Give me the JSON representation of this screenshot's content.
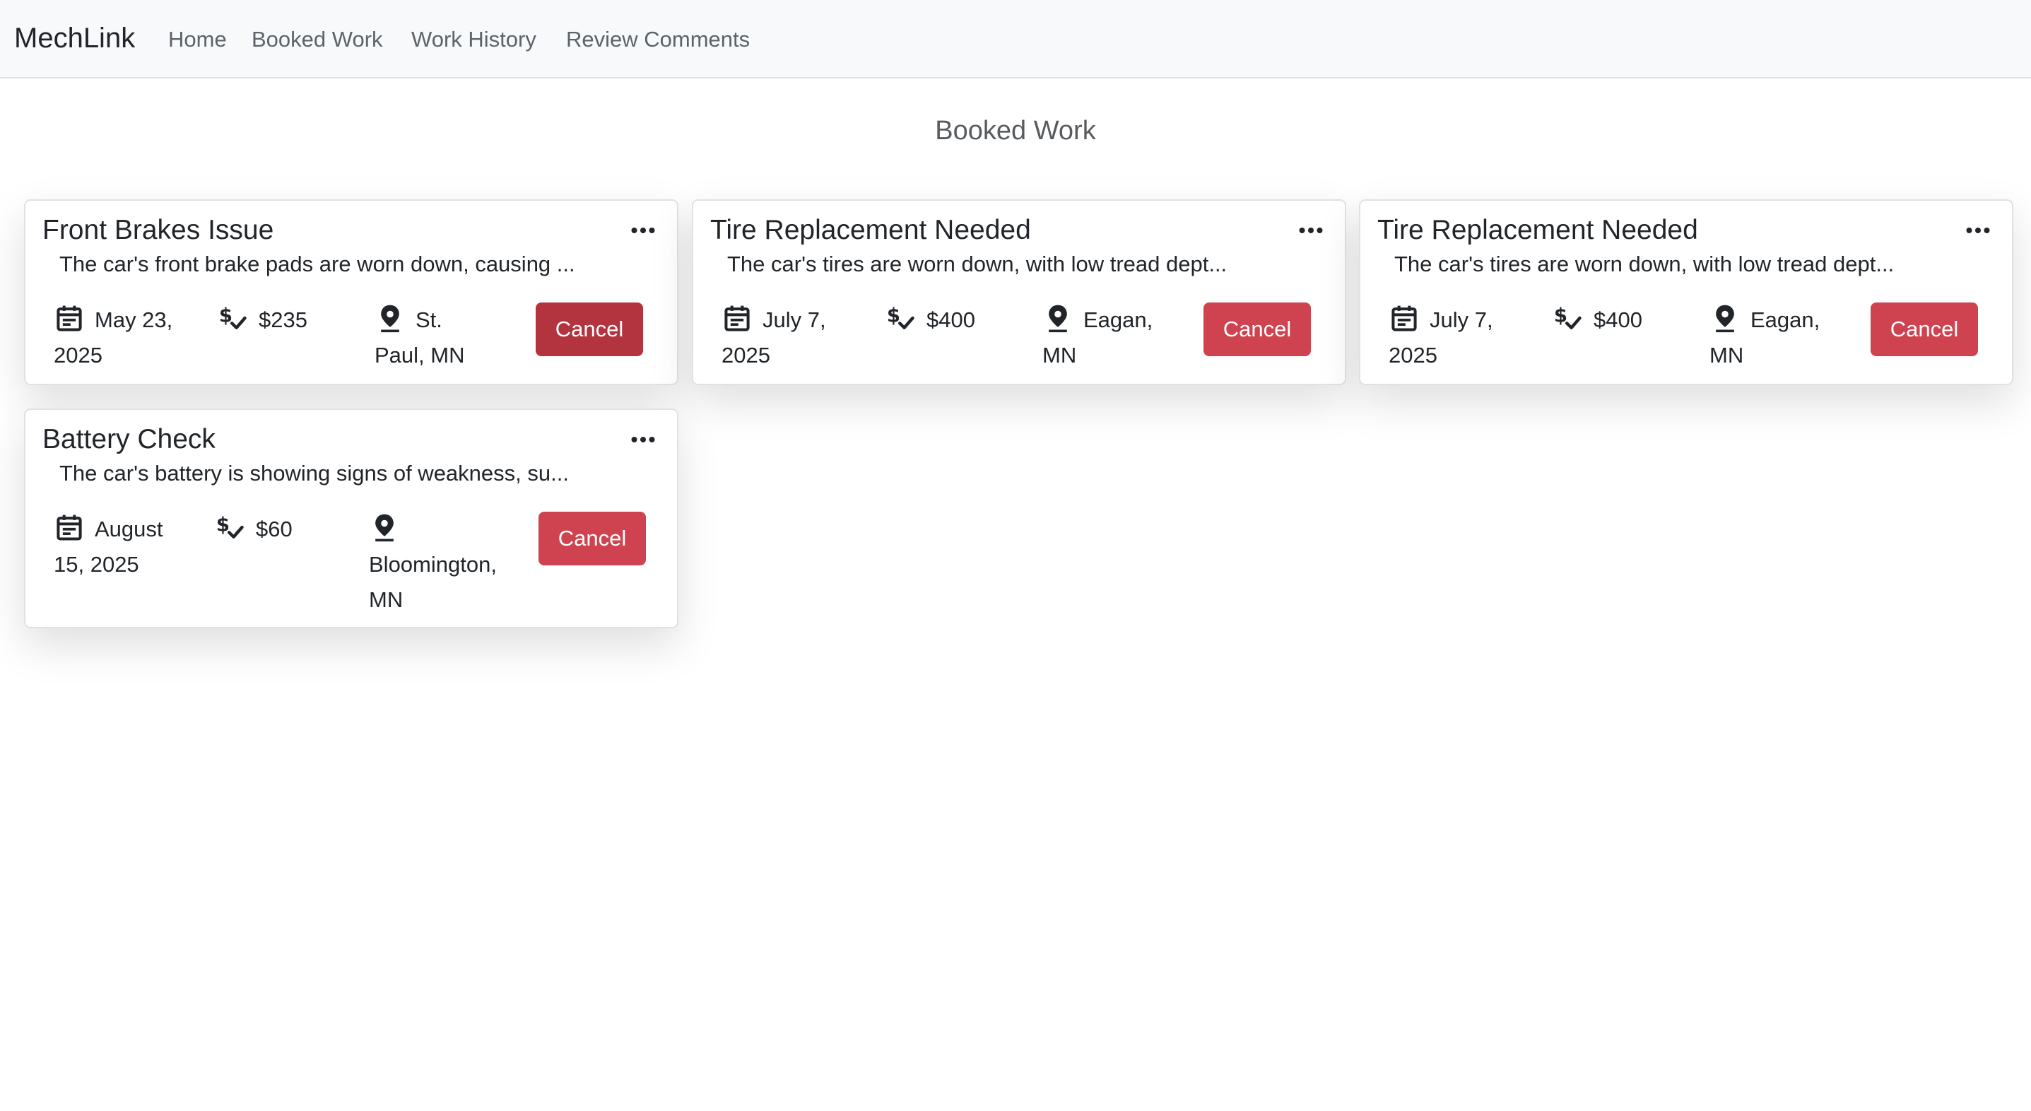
{
  "navbar": {
    "brand": "MechLink",
    "links": [
      "Home",
      "Booked Work",
      "Work History",
      "Review Comments"
    ]
  },
  "page": {
    "title": "Booked Work"
  },
  "colors": {
    "danger": "#cf424f",
    "danger_active": "#b3343f",
    "navbar_bg": "#f8f9fa"
  },
  "icons": {
    "menu": "more-horizontal-icon",
    "date": "calendar-icon",
    "price": "dollar-check-icon",
    "location": "map-pin-icon"
  },
  "cards": [
    {
      "title": "Front Brakes Issue",
      "description": "The car's front brake pads are worn down, causing ...",
      "date": [
        "May 23,",
        "2025"
      ],
      "price": "$235",
      "location": [
        "St.",
        "Paul, MN"
      ],
      "action": "Cancel"
    },
    {
      "title": "Tire Replacement Needed",
      "description": "The car's tires are worn down, with low tread dept...",
      "date": [
        "July 7,",
        "2025"
      ],
      "price": "$400",
      "location": [
        "Eagan,",
        "MN"
      ],
      "action": "Cancel"
    },
    {
      "title": "Tire Replacement Needed",
      "description": "The car's tires are worn down, with low tread dept...",
      "date": [
        "July 7,",
        "2025"
      ],
      "price": "$400",
      "location": [
        "Eagan,",
        "MN"
      ],
      "action": "Cancel"
    },
    {
      "title": "Battery Check",
      "description": "The car's battery is showing signs of weakness, su...",
      "date": [
        "August",
        "15, 2025"
      ],
      "price": "$60",
      "location": [
        "",
        "Bloomington,",
        "MN"
      ],
      "action": "Cancel"
    }
  ]
}
